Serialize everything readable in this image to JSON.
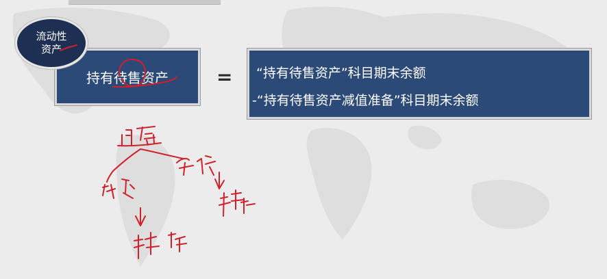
{
  "badge": {
    "line1": "流动性",
    "line2": "资产"
  },
  "left_box": {
    "label": "持有待售资产"
  },
  "operator": "=",
  "right_box": {
    "line1": "“持有待售资产”科目期末余额",
    "line2": "-“持有待售资产减值准备”科目期末余额"
  },
  "colors": {
    "box_fill": "#2c4a78",
    "badge_fill": "#1d2f52",
    "ink": "#d0202a",
    "background": "#ececec"
  }
}
